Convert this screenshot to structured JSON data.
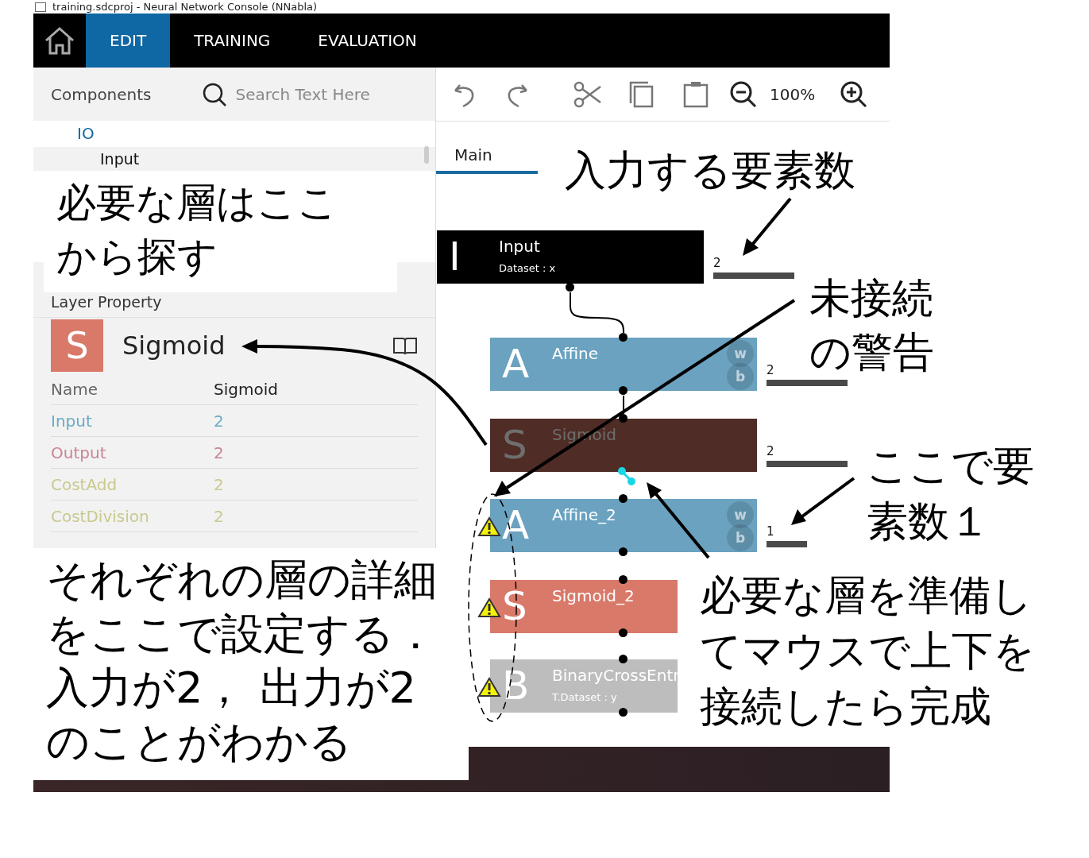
{
  "title_bar": {
    "title": "training.sdcproj - Neural Network Console (NNabla)"
  },
  "nav": {
    "tabs": [
      {
        "label": "EDIT",
        "selected": true
      },
      {
        "label": "TRAINING",
        "selected": false
      },
      {
        "label": "EVALUATION",
        "selected": false
      }
    ]
  },
  "components": {
    "title": "Components",
    "search": {
      "placeholder": "Search Text Here"
    },
    "tree": [
      {
        "label": "IO",
        "children": [
          {
            "label": "Input"
          }
        ]
      }
    ]
  },
  "layer_property": {
    "title": "Layer Property",
    "layer": {
      "letter": "S",
      "name": "Sigmoid",
      "color": "#d9796a"
    },
    "rows": [
      {
        "name": "Name",
        "value": "Sigmoid",
        "color": "#666666"
      },
      {
        "name": "Input",
        "value": "2",
        "color": "#6aaac8"
      },
      {
        "name": "Output",
        "value": "2",
        "color": "#c98494"
      },
      {
        "name": "CostAdd",
        "value": "2",
        "color": "#c9c98f"
      },
      {
        "name": "CostDivision",
        "value": "2",
        "color": "#c9c98f"
      }
    ]
  },
  "toolbar": {
    "zoom": "100%"
  },
  "tabs": [
    {
      "label": "Main",
      "selected": true
    }
  ],
  "nodes": [
    {
      "letter": "I",
      "name": "Input",
      "detail": "Dataset : x",
      "color": "#000000",
      "selected": false,
      "warning": false,
      "size": "2"
    },
    {
      "letter": "A",
      "name": "Affine",
      "params": [
        "w",
        "b"
      ],
      "color": "#6aa2c0",
      "selected": false,
      "warning": false,
      "connected": true,
      "size": "2"
    },
    {
      "letter": "S",
      "name": "Sigmoid",
      "color": "#4f2c25",
      "selected": true,
      "warning": false,
      "connected": true,
      "size": "2"
    },
    {
      "letter": "A",
      "name": "Affine_2",
      "params": [
        "w",
        "b"
      ],
      "color": "#6aa2c0",
      "selected": false,
      "warning": true,
      "connected": false,
      "size": "1"
    },
    {
      "letter": "S",
      "name": "Sigmoid_2",
      "color": "#d9796a",
      "selected": false,
      "warning": true,
      "connected": false
    },
    {
      "letter": "B",
      "name": "BinaryCrossEntr",
      "detail": "T.Dataset : y",
      "color": "#bdbdbd",
      "selected": false,
      "warning": true,
      "connected": false
    }
  ],
  "callouts": [
    {
      "lines": [
        "必要な層はここ",
        "から探す"
      ]
    },
    {
      "lines": [
        "入力する要素数"
      ]
    },
    {
      "lines": [
        "未接続",
        "の警告"
      ]
    },
    {
      "lines": [
        "ここで要",
        "素数１"
      ]
    },
    {
      "lines": [
        "それぞれの層の詳細",
        "をここで設定する．",
        "入力が2， 出力が2",
        "のことがわかる"
      ]
    },
    {
      "lines": [
        "必要な層を準備し",
        "てマウスで上下を",
        "接続したら完成"
      ]
    }
  ]
}
